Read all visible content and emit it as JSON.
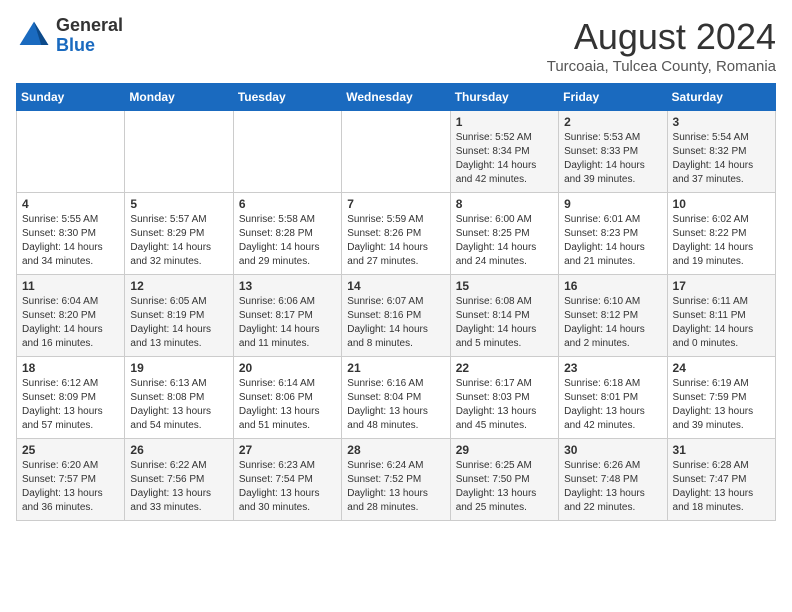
{
  "logo": {
    "general": "General",
    "blue": "Blue"
  },
  "title": "August 2024",
  "subtitle": "Turcoaia, Tulcea County, Romania",
  "days": [
    "Sunday",
    "Monday",
    "Tuesday",
    "Wednesday",
    "Thursday",
    "Friday",
    "Saturday"
  ],
  "weeks": [
    [
      {
        "day": "",
        "text": ""
      },
      {
        "day": "",
        "text": ""
      },
      {
        "day": "",
        "text": ""
      },
      {
        "day": "",
        "text": ""
      },
      {
        "day": "1",
        "text": "Sunrise: 5:52 AM\nSunset: 8:34 PM\nDaylight: 14 hours\nand 42 minutes."
      },
      {
        "day": "2",
        "text": "Sunrise: 5:53 AM\nSunset: 8:33 PM\nDaylight: 14 hours\nand 39 minutes."
      },
      {
        "day": "3",
        "text": "Sunrise: 5:54 AM\nSunset: 8:32 PM\nDaylight: 14 hours\nand 37 minutes."
      }
    ],
    [
      {
        "day": "4",
        "text": "Sunrise: 5:55 AM\nSunset: 8:30 PM\nDaylight: 14 hours\nand 34 minutes."
      },
      {
        "day": "5",
        "text": "Sunrise: 5:57 AM\nSunset: 8:29 PM\nDaylight: 14 hours\nand 32 minutes."
      },
      {
        "day": "6",
        "text": "Sunrise: 5:58 AM\nSunset: 8:28 PM\nDaylight: 14 hours\nand 29 minutes."
      },
      {
        "day": "7",
        "text": "Sunrise: 5:59 AM\nSunset: 8:26 PM\nDaylight: 14 hours\nand 27 minutes."
      },
      {
        "day": "8",
        "text": "Sunrise: 6:00 AM\nSunset: 8:25 PM\nDaylight: 14 hours\nand 24 minutes."
      },
      {
        "day": "9",
        "text": "Sunrise: 6:01 AM\nSunset: 8:23 PM\nDaylight: 14 hours\nand 21 minutes."
      },
      {
        "day": "10",
        "text": "Sunrise: 6:02 AM\nSunset: 8:22 PM\nDaylight: 14 hours\nand 19 minutes."
      }
    ],
    [
      {
        "day": "11",
        "text": "Sunrise: 6:04 AM\nSunset: 8:20 PM\nDaylight: 14 hours\nand 16 minutes."
      },
      {
        "day": "12",
        "text": "Sunrise: 6:05 AM\nSunset: 8:19 PM\nDaylight: 14 hours\nand 13 minutes."
      },
      {
        "day": "13",
        "text": "Sunrise: 6:06 AM\nSunset: 8:17 PM\nDaylight: 14 hours\nand 11 minutes."
      },
      {
        "day": "14",
        "text": "Sunrise: 6:07 AM\nSunset: 8:16 PM\nDaylight: 14 hours\nand 8 minutes."
      },
      {
        "day": "15",
        "text": "Sunrise: 6:08 AM\nSunset: 8:14 PM\nDaylight: 14 hours\nand 5 minutes."
      },
      {
        "day": "16",
        "text": "Sunrise: 6:10 AM\nSunset: 8:12 PM\nDaylight: 14 hours\nand 2 minutes."
      },
      {
        "day": "17",
        "text": "Sunrise: 6:11 AM\nSunset: 8:11 PM\nDaylight: 14 hours\nand 0 minutes."
      }
    ],
    [
      {
        "day": "18",
        "text": "Sunrise: 6:12 AM\nSunset: 8:09 PM\nDaylight: 13 hours\nand 57 minutes."
      },
      {
        "day": "19",
        "text": "Sunrise: 6:13 AM\nSunset: 8:08 PM\nDaylight: 13 hours\nand 54 minutes."
      },
      {
        "day": "20",
        "text": "Sunrise: 6:14 AM\nSunset: 8:06 PM\nDaylight: 13 hours\nand 51 minutes."
      },
      {
        "day": "21",
        "text": "Sunrise: 6:16 AM\nSunset: 8:04 PM\nDaylight: 13 hours\nand 48 minutes."
      },
      {
        "day": "22",
        "text": "Sunrise: 6:17 AM\nSunset: 8:03 PM\nDaylight: 13 hours\nand 45 minutes."
      },
      {
        "day": "23",
        "text": "Sunrise: 6:18 AM\nSunset: 8:01 PM\nDaylight: 13 hours\nand 42 minutes."
      },
      {
        "day": "24",
        "text": "Sunrise: 6:19 AM\nSunset: 7:59 PM\nDaylight: 13 hours\nand 39 minutes."
      }
    ],
    [
      {
        "day": "25",
        "text": "Sunrise: 6:20 AM\nSunset: 7:57 PM\nDaylight: 13 hours\nand 36 minutes."
      },
      {
        "day": "26",
        "text": "Sunrise: 6:22 AM\nSunset: 7:56 PM\nDaylight: 13 hours\nand 33 minutes."
      },
      {
        "day": "27",
        "text": "Sunrise: 6:23 AM\nSunset: 7:54 PM\nDaylight: 13 hours\nand 30 minutes."
      },
      {
        "day": "28",
        "text": "Sunrise: 6:24 AM\nSunset: 7:52 PM\nDaylight: 13 hours\nand 28 minutes."
      },
      {
        "day": "29",
        "text": "Sunrise: 6:25 AM\nSunset: 7:50 PM\nDaylight: 13 hours\nand 25 minutes."
      },
      {
        "day": "30",
        "text": "Sunrise: 6:26 AM\nSunset: 7:48 PM\nDaylight: 13 hours\nand 22 minutes."
      },
      {
        "day": "31",
        "text": "Sunrise: 6:28 AM\nSunset: 7:47 PM\nDaylight: 13 hours\nand 18 minutes."
      }
    ]
  ]
}
